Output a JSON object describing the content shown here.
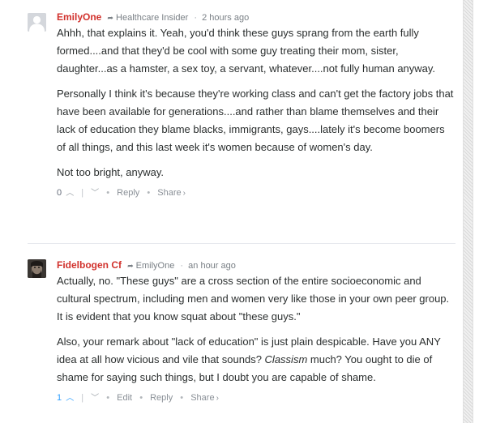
{
  "comments": [
    {
      "author": "EmilyOne",
      "reply_to": "Healthcare Insider",
      "time": "2 hours ago",
      "paragraphs": [
        "Ahhh, that explains it. Yeah, you'd think these guys sprang from the earth fully formed....and that they'd be cool with some guy treating their mom, sister, daughter...as a hamster, a sex toy, a servant, whatever....not fully human anyway.",
        "Personally I think it's because they're working class and can't get the factory jobs that have been available for generations....and rather than blame themselves and their lack of education they blame blacks, immigrants, gays....lately it's become boomers of all things, and this last week it's women because of women's day.",
        "Not too bright, anyway."
      ],
      "votes": "0",
      "reply_label": "Reply",
      "share_label": "Share"
    },
    {
      "author": "Fidelbogen Cf",
      "reply_to": "EmilyOne",
      "time": "an hour ago",
      "paragraphs": [
        "Actually, no. \"These guys\" are a cross section of the entire socioeconomic and cultural spectrum, including men and women very like those in your own peer group. It is evident that you know squat about \"these guys.\""
      ],
      "p2_before": "Also, your remark about \"lack of education\" is just plain despicable. Have you ANY idea at all how vicious and vile that sounds? ",
      "p2_em": "Classism",
      "p2_after": " much? You ought to die of shame for saying such things, but I doubt you are capable of shame.",
      "votes": "1",
      "edit_label": "Edit",
      "reply_label": "Reply",
      "share_label": "Share"
    }
  ],
  "icons": {
    "reply_arrow": "share-arrow-icon",
    "upvote": "chevron-up-icon",
    "downvote": "chevron-down-icon",
    "share_chevron": "chevron-right-icon"
  },
  "colors": {
    "author": "#d1312c",
    "active_vote": "#2e9fff",
    "meta": "#7a8086"
  }
}
